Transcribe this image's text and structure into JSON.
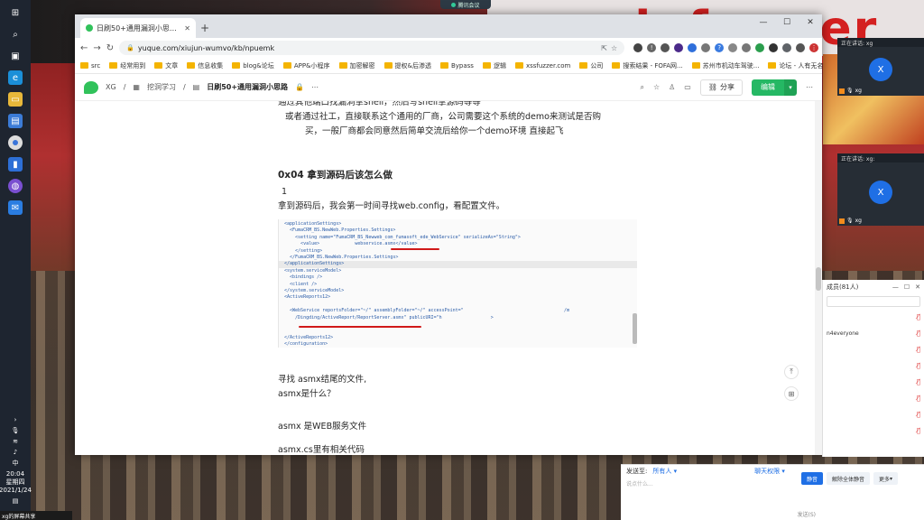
{
  "meeting_indicator": "腾讯会议",
  "desktop_banner": "ame:informer",
  "taskbar": {
    "clock_time": "20:04",
    "clock_day": "星期四",
    "clock_date": "2021/1/24",
    "ime": "中",
    "footer_text": "xg的屏幕共享"
  },
  "browser": {
    "tab_title": "日刷50+通用漏洞小思路 · 语雀",
    "url": "yuque.com/xiujun-wumvo/kb/npuemk",
    "bookmarks": [
      "src",
      "经常用到",
      "文章",
      "信息收集",
      "blog&论坛",
      "APP&小程序",
      "加密解密",
      "提权&后渗透",
      "Bypass",
      "逻辑",
      "xssfuzzer.com",
      "公司",
      "搜索结果 - FOFA网...",
      "苏州市机动车驾驶...",
      "论坛 - 人有无名..."
    ]
  },
  "yuque": {
    "crumb_user": "XG",
    "crumb_kb": "挖洞学习",
    "crumb_doc": "日刷50+通用漏洞小思路",
    "share_label": "分享",
    "edit_label": "编辑"
  },
  "doc": {
    "lines_top": [
      "通过其他端口找漏洞拿shell，然后写shell拿源码等等",
      "或者通过社工，直接联系这个通用的厂商，公司需要这个系统的demo来测试是否购",
      "买，一般厂商都会同意然后简单交流后给你一个demo环境  直接起飞"
    ],
    "heading": "0x04 拿到源码后该怎么做",
    "num": "1",
    "para1": "拿到源码后，我会第一时间寻找web.config，看配置文件。",
    "code": [
      "<applicationSettings>",
      "  <FumaCRM_BS.NewWeb.Properties.Settings>",
      "    <setting name=\"FumaCRM_BS_Newweb_com_fumasoft_ede_WebService\" serializeAs=\"String\">",
      "      <value>             webservice.asmx</value>",
      "    </setting>",
      "  </FumaCRM_BS.NewWeb.Properties.Settings>",
      "</applicationSettings>",
      "<system.serviceModel>",
      "  <bindings />",
      "  <client />",
      "</system.serviceModel>",
      "<ActiveReports12>",
      "",
      "  <WebService reportsFolder=\"~/\" assemblyFolder=\"~/\" accessPoint=\"                                     /m",
      "    /Dingding/ActiveReport/ReportServer.asmx\" publicURI=\"h                  >",
      "",
      "",
      "</ActiveReports12>",
      "</configuration>"
    ],
    "para2": "寻找 asmx结尾的文件,",
    "para3": "asmx是什么？",
    "para4": "asmx 是WEB服务文件",
    "para5": "asmx.cs里有相关代码"
  },
  "meeting": {
    "tile1_header": "正在讲话: xg",
    "tile2_header": "正在讲话: xg:",
    "avatar_letter": "X",
    "user": "xg",
    "members_title": "成员(81人)",
    "member_visible": "n4everyone",
    "send_to_label": "发送至:",
    "send_to_value": "所有人",
    "chat_perm": "聊天权限",
    "chat_placeholder": "说点什么...",
    "mute_btn": "静音",
    "unmute_all_btn": "解除全体静音",
    "more_btn": "更多",
    "send_btn": "发送(S)"
  }
}
